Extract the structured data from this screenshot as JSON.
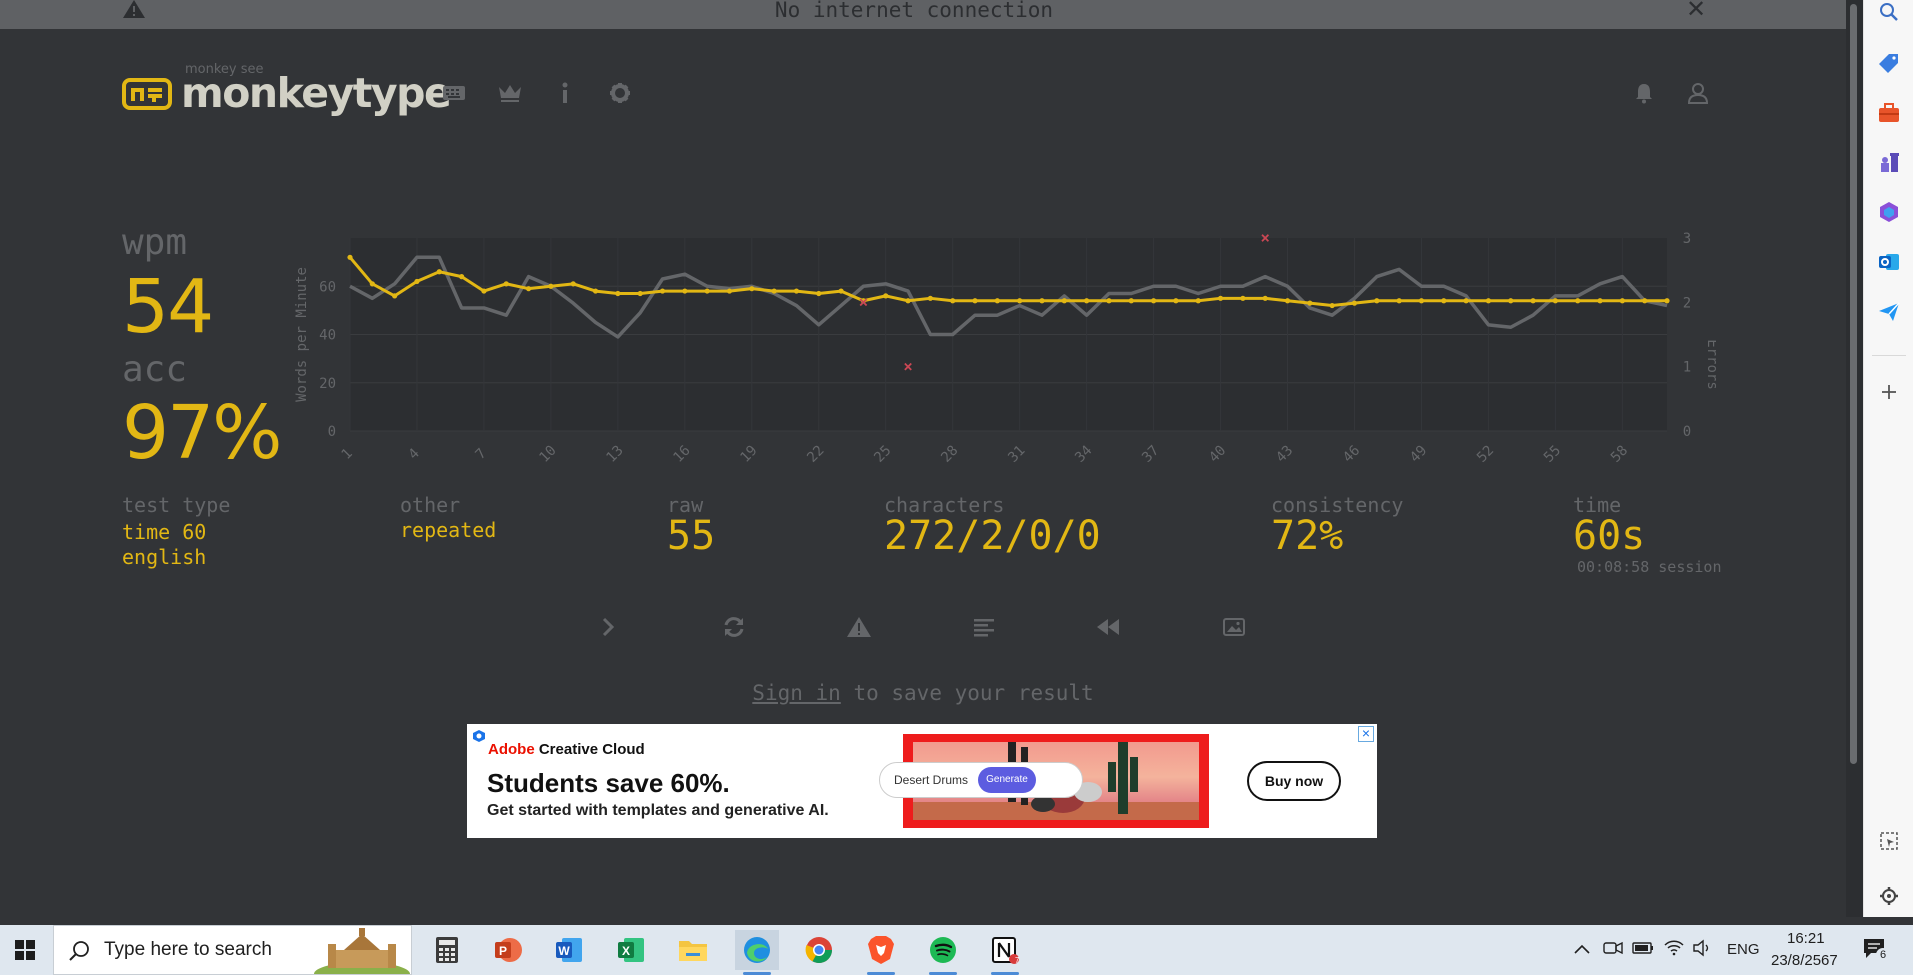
{
  "banner": {
    "text": "No internet connection",
    "close": "✕"
  },
  "header": {
    "logo_small": "monkey see",
    "logo_name": "monkeytype"
  },
  "result": {
    "wpm_label": "wpm",
    "wpm_value": "54",
    "acc_label": "acc",
    "acc_value": "97%",
    "test_type_label": "test type",
    "test_type_value": "time 60",
    "test_language": "english",
    "other_label": "other",
    "other_value": "repeated",
    "raw_label": "raw",
    "raw_value": "55",
    "characters_label": "characters",
    "characters_value": "272/2/0/0",
    "consistency_label": "consistency",
    "consistency_value": "72%",
    "time_label": "time",
    "time_value": "60s",
    "session_value": "00:08:58 session"
  },
  "signin": {
    "link": "Sign in",
    "rest": " to save your result"
  },
  "ad": {
    "brand_red": "Adobe",
    "brand_rest": " Creative Cloud",
    "headline": "Students save 60%.",
    "subline": "Get started with templates and generative AI.",
    "pill_text": "Desert Drums",
    "generate_label": "Generate",
    "buy_label": "Buy now",
    "close": "×"
  },
  "taskbar": {
    "search_placeholder": "Type here to search",
    "lang": "ENG",
    "time": "16:21",
    "date": "23/8/2567",
    "notification_count": "6",
    "notion_badge": "7"
  },
  "colors": {
    "main": "#e2b714",
    "sub": "#646669",
    "text": "#d1d0c5",
    "bg": "#323437",
    "error": "#ca4754",
    "raw_line": "#646669"
  },
  "chart_data": {
    "type": "line",
    "ylabel": "Words per Minute",
    "y2label": "Errors",
    "ylim": [
      0,
      80
    ],
    "y2lim": [
      0,
      3
    ],
    "yticks": [
      0,
      20,
      40,
      60
    ],
    "y2ticks": [
      0,
      1,
      2,
      3
    ],
    "xticks": [
      "1",
      "4",
      "7",
      "10",
      "13",
      "16",
      "19",
      "22",
      "25",
      "28",
      "31",
      "34",
      "37",
      "40",
      "43",
      "46",
      "49",
      "52",
      "55",
      "58"
    ],
    "x": [
      1,
      2,
      3,
      4,
      5,
      6,
      7,
      8,
      9,
      10,
      11,
      12,
      13,
      14,
      15,
      16,
      17,
      18,
      19,
      20,
      21,
      22,
      23,
      24,
      25,
      26,
      27,
      28,
      29,
      30,
      31,
      32,
      33,
      34,
      35,
      36,
      37,
      38,
      39,
      40,
      41,
      42,
      43,
      44,
      45,
      46,
      47,
      48,
      49,
      50,
      51,
      52,
      53,
      54,
      55,
      56,
      57,
      58,
      59,
      60
    ],
    "series": [
      {
        "name": "wpm",
        "values": [
          72,
          61,
          56,
          62,
          66,
          64,
          58,
          61,
          59,
          60,
          61,
          58,
          57,
          57,
          58,
          58,
          58,
          58,
          59,
          58,
          58,
          57,
          58,
          54,
          56,
          54,
          55,
          54,
          54,
          54,
          54,
          54,
          54,
          54,
          54,
          54,
          54,
          54,
          54,
          55,
          55,
          55,
          54,
          53,
          52,
          53,
          54,
          54,
          54,
          54,
          54,
          54,
          54,
          54,
          54,
          54,
          54,
          54,
          54,
          54
        ]
      },
      {
        "name": "raw",
        "values": [
          60,
          55,
          61,
          72,
          72,
          51,
          51,
          48,
          64,
          60,
          53,
          45,
          39,
          49,
          63,
          65,
          60,
          59,
          60,
          57,
          52,
          44,
          52,
          60,
          61,
          58,
          40,
          40,
          48,
          48,
          52,
          48,
          56,
          48,
          57,
          57,
          60,
          60,
          57,
          60,
          60,
          64,
          60,
          51,
          48,
          55,
          64,
          67,
          60,
          60,
          56,
          44,
          43,
          48,
          56,
          56,
          61,
          64,
          54,
          52
        ]
      }
    ],
    "errors": [
      {
        "x": 24,
        "y": 2
      },
      {
        "x": 26,
        "y": 1
      },
      {
        "x": 42,
        "y": 3
      }
    ]
  }
}
